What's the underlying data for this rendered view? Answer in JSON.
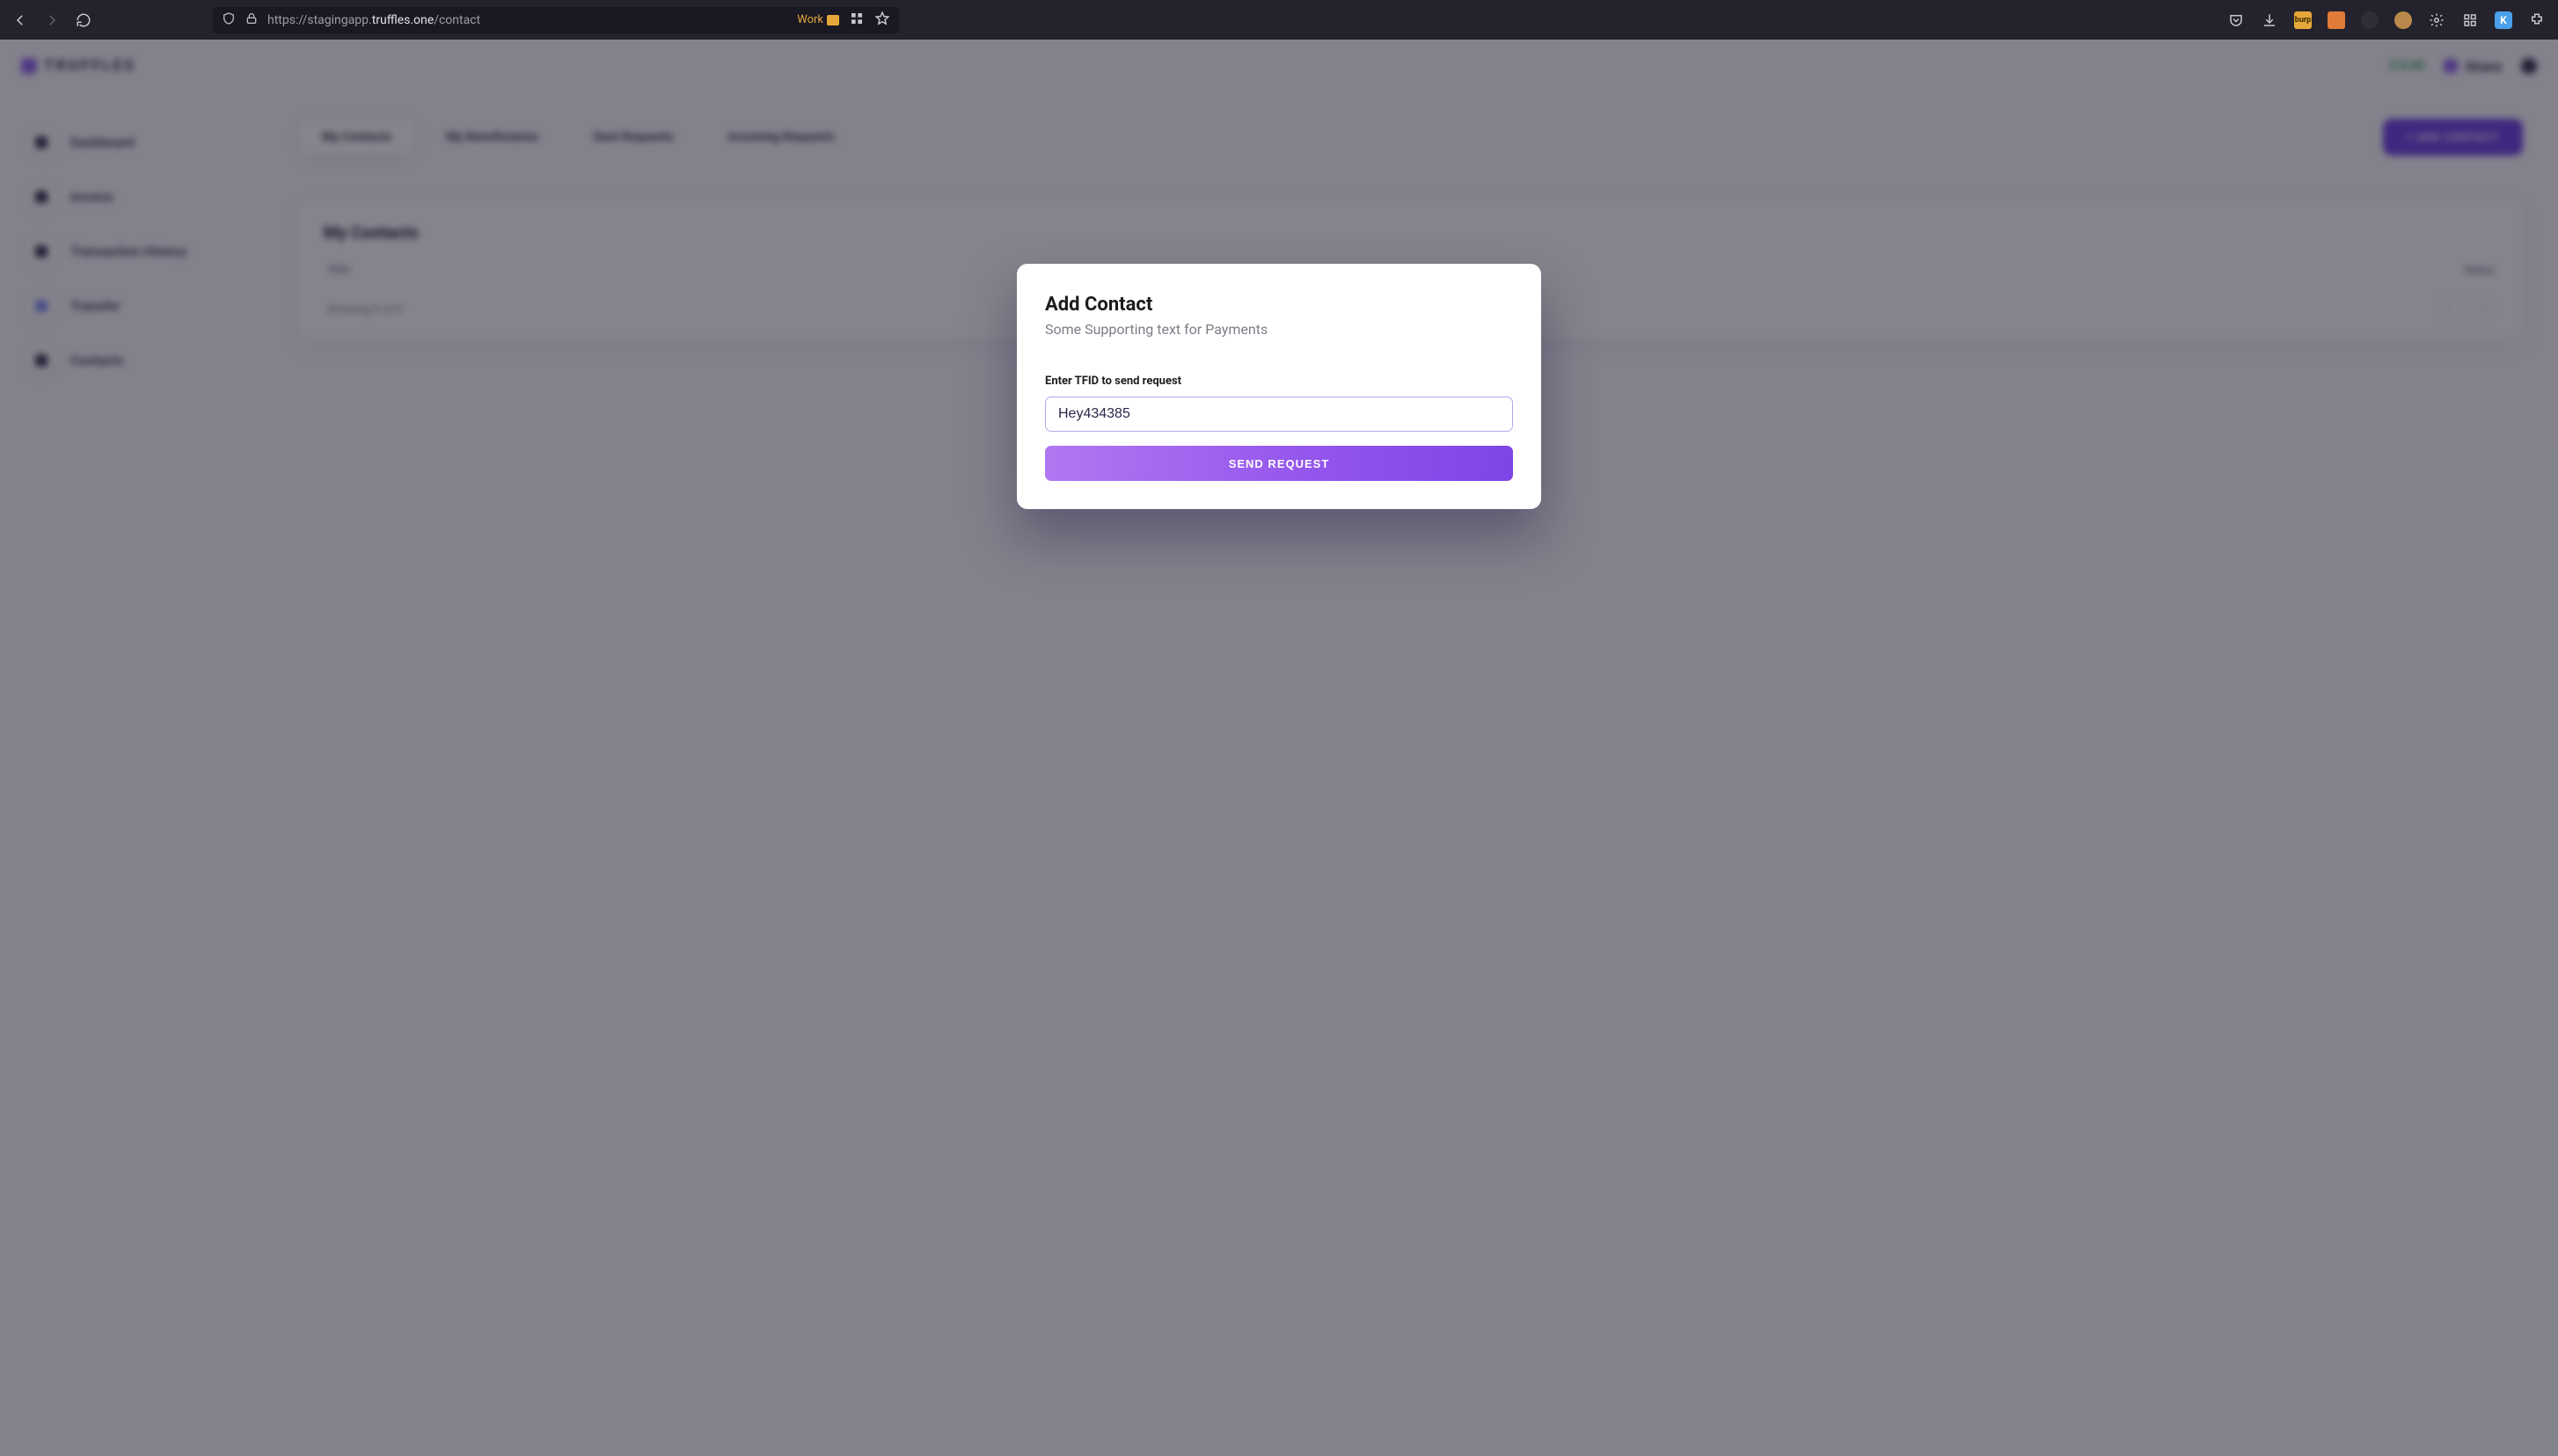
{
  "browser": {
    "url_prefix": "https://stagingapp.",
    "url_domain": "truffles.one",
    "url_path": "/contact",
    "work_label": "Work"
  },
  "header": {
    "brand": "TRUFFLES",
    "balance": "$ 0.00",
    "share": "Share"
  },
  "sidebar": {
    "items": [
      {
        "label": "Dashboard"
      },
      {
        "label": "Invoice"
      },
      {
        "label": "Transaction History"
      },
      {
        "label": "Transfer"
      },
      {
        "label": "Contacts"
      }
    ]
  },
  "tabs": {
    "items": [
      {
        "label": "My Contacts",
        "active": true
      },
      {
        "label": "My Beneficiaries",
        "active": false
      },
      {
        "label": "Sent Requests",
        "active": false
      },
      {
        "label": "Incoming Requests",
        "active": false
      }
    ],
    "add_button": "+ ADD CONTACT"
  },
  "panel": {
    "title": "My Contacts",
    "columns": {
      "tfid": "TFID",
      "status": "Status"
    },
    "footer_showing": "Showing 0 of 0"
  },
  "modal": {
    "title": "Add Contact",
    "subtitle": "Some Supporting text for Payments",
    "field_label": "Enter TFID to send request",
    "input_value": "Hey434385",
    "submit": "SEND REQUEST"
  }
}
